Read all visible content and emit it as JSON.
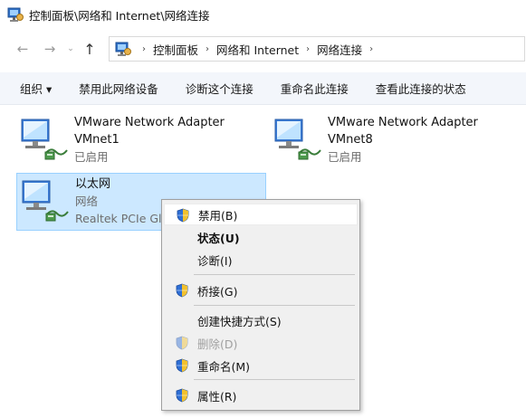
{
  "window": {
    "title": "控制面板\\网络和 Internet\\网络连接",
    "title_icon": "control-panel-icon"
  },
  "nav": {
    "back": "←",
    "forward": "→",
    "recent": "⌄",
    "up": "↑",
    "breadcrumb_separator": "›",
    "breadcrumb": [
      "控制面板",
      "网络和 Internet",
      "网络连接"
    ]
  },
  "toolbar": {
    "organize": "组织 ▾",
    "disable_device": "禁用此网络设备",
    "diagnose": "诊断这个连接",
    "rename": "重命名此连接",
    "view_status": "查看此连接的状态"
  },
  "adapters": [
    {
      "name": "VMware Network Adapter",
      "name2": "VMnet1",
      "status": "已启用",
      "icon": "network-adapter-icon"
    },
    {
      "name": "VMware Network Adapter",
      "name2": "VMnet8",
      "status": "已启用",
      "icon": "network-adapter-icon"
    },
    {
      "name": "以太网",
      "name2": "网络",
      "status": "Realtek PCIe GbE Family Controller",
      "status_visible": "Realtek PCIe Gl",
      "icon": "network-adapter-icon",
      "selected": true
    }
  ],
  "context_menu": {
    "items": [
      {
        "label": "禁用(B)",
        "shield": true
      },
      {
        "label": "状态(U)",
        "shield": false,
        "bold": true
      },
      {
        "label": "诊断(I)",
        "shield": false
      },
      {
        "label": "桥接(G)",
        "shield": true
      },
      {
        "label": "创建快捷方式(S)",
        "shield": false
      },
      {
        "label": "删除(D)",
        "shield": true,
        "disabled": true
      },
      {
        "label": "重命名(M)",
        "shield": true
      },
      {
        "label": "属性(R)",
        "shield": true
      }
    ]
  },
  "colors": {
    "selection_bg": "#cce8ff",
    "selection_border": "#99d1ff",
    "toolbar_bg": "#f3f6fb",
    "menu_bg": "#f0f0f0"
  }
}
